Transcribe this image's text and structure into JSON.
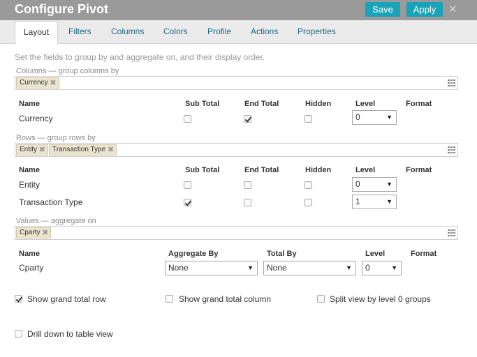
{
  "dialog": {
    "title": "Configure Pivot",
    "save_label": "Save",
    "apply_label": "Apply",
    "close_glyph": "✕"
  },
  "tabs": [
    {
      "label": "Layout",
      "active": true
    },
    {
      "label": "Filters"
    },
    {
      "label": "Columns"
    },
    {
      "label": "Colors"
    },
    {
      "label": "Profile"
    },
    {
      "label": "Actions"
    },
    {
      "label": "Properties"
    }
  ],
  "layout": {
    "hint": "Set the fields to group by and aggregate on, and their display order.",
    "columns_section": {
      "label": "Columns — group columns by",
      "chips": [
        "Currency"
      ],
      "headers": [
        "Name",
        "Sub Total",
        "End Total",
        "Hidden",
        "Level",
        "Format"
      ],
      "rows": [
        {
          "name": "Currency",
          "sub_total": false,
          "end_total": true,
          "hidden": false,
          "level": "0"
        }
      ]
    },
    "rows_section": {
      "label": "Rows — group rows by",
      "chips": [
        "Entity",
        "Transaction Type"
      ],
      "headers": [
        "Name",
        "Sub Total",
        "End Total",
        "Hidden",
        "Level",
        "Format"
      ],
      "rows": [
        {
          "name": "Entity",
          "sub_total": false,
          "end_total": false,
          "hidden": false,
          "level": "0"
        },
        {
          "name": "Transaction Type",
          "sub_total": true,
          "end_total": false,
          "hidden": false,
          "level": "1"
        }
      ]
    },
    "values_section": {
      "label": "Values — aggregate on",
      "chips": [
        "Cparty"
      ],
      "headers": [
        "Name",
        "Aggregate By",
        "Total By",
        "Level",
        "Format"
      ],
      "rows": [
        {
          "name": "Cparty",
          "aggregate_by": "None",
          "total_by": "None",
          "level": "0"
        }
      ]
    },
    "options": {
      "show_grand_total_row": {
        "label": "Show grand total row",
        "checked": true
      },
      "show_grand_total_column": {
        "label": "Show grand total column",
        "checked": false
      },
      "split_view": {
        "label": "Split view by level 0 groups",
        "checked": false
      },
      "drill_down": {
        "label": "Drill down to table view",
        "checked": false
      }
    }
  },
  "icons": {
    "chip_remove": "✖",
    "dropdown_arrow": "▼",
    "dropzone_handle": "grid-icon"
  },
  "colors": {
    "titlebar": "#9a9a9a",
    "accent": "#1aa2b8",
    "tab_link": "#1f6a84",
    "chip_bg": "#ece4cf"
  }
}
